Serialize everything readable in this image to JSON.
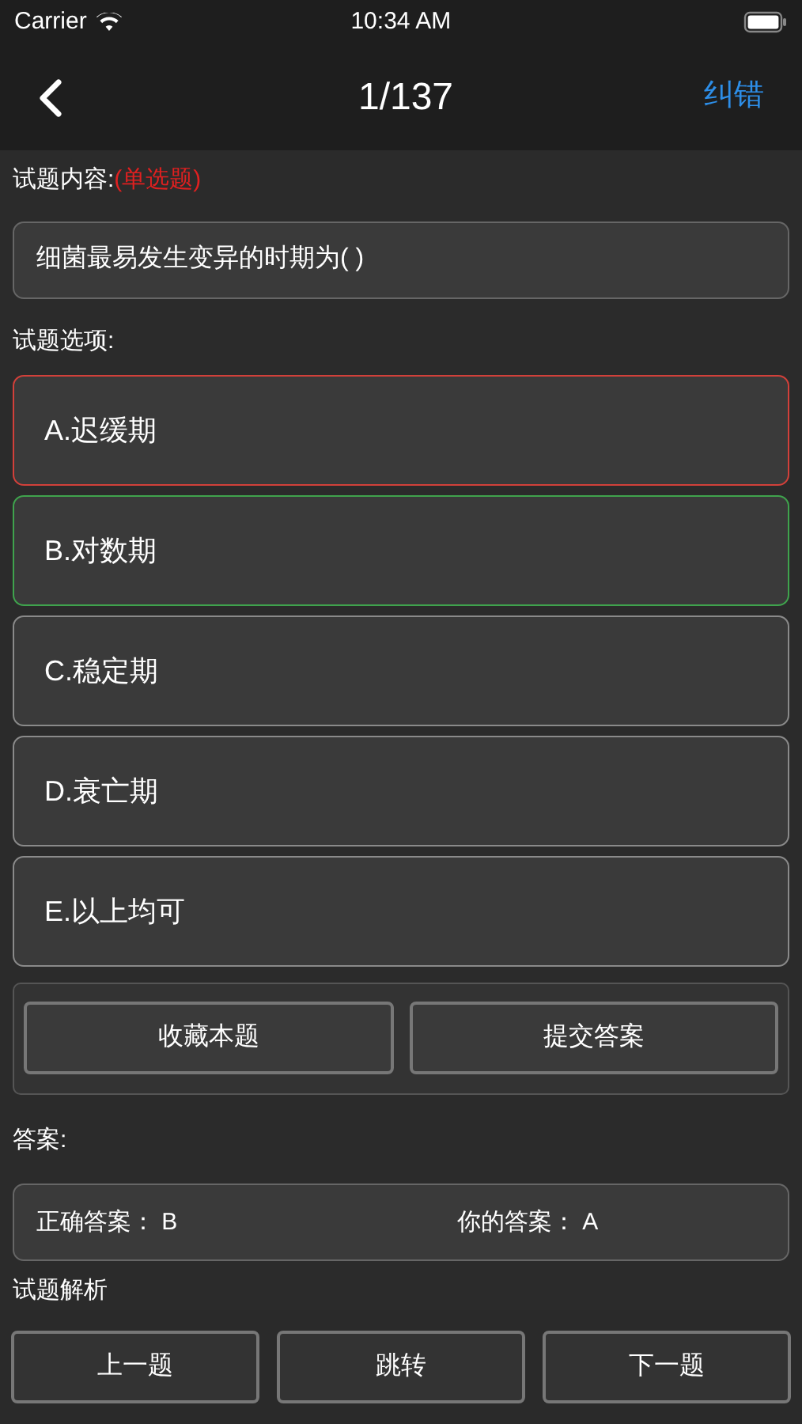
{
  "status_bar": {
    "carrier": "Carrier",
    "time": "10:34 AM"
  },
  "nav": {
    "title": "1/137",
    "action": "纠错"
  },
  "question": {
    "label": "试题内容:",
    "type_tag": "(单选题)",
    "text": "细菌最易发生变异的时期为( )"
  },
  "options_label": "试题选项:",
  "options": [
    {
      "text": "A.迟缓期",
      "selected": true,
      "correct": false
    },
    {
      "text": "B.对数期",
      "selected": false,
      "correct": true
    },
    {
      "text": "C.稳定期",
      "selected": false,
      "correct": false
    },
    {
      "text": "D.衰亡期",
      "selected": false,
      "correct": false
    },
    {
      "text": "E.以上均可",
      "selected": false,
      "correct": false
    }
  ],
  "actions": [
    "收藏本题",
    "提交答案"
  ],
  "answer": {
    "label": "答案:",
    "correct_label": "正确答案：",
    "correct_value": "B",
    "yours_label": "你的答案：",
    "yours_value": "A"
  },
  "analysis_label": "试题解析",
  "bottom_buttons": [
    "上一题",
    "跳转",
    "下一题"
  ]
}
